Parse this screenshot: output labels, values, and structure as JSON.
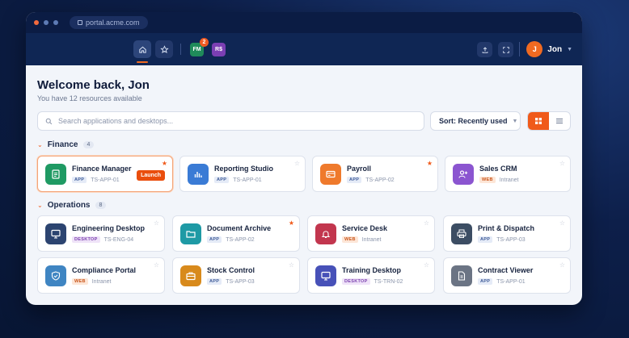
{
  "browser": {
    "url": "portal.acme.com"
  },
  "appbar": {
    "chips": [
      {
        "label": "FM",
        "color": "#1f8a5a",
        "badge": "2"
      },
      {
        "label": "R$",
        "color": "#7b3fb3"
      }
    ],
    "user": {
      "initial": "J",
      "name": "Jon"
    }
  },
  "header": {
    "title": "Welcome back, Jon",
    "subtitle": "You have 12 resources available"
  },
  "search": {
    "placeholder": "Search applications and desktops..."
  },
  "sort": {
    "label": "Sort: Recently used"
  },
  "colors": {
    "accent": "#f05a1a",
    "navy": "#0f2654"
  },
  "sections": [
    {
      "title": "Finance",
      "count": "4",
      "items": [
        {
          "name": "Finance Manager",
          "tag": "APP",
          "code": "TS-APP-01",
          "icon": "document-icon",
          "color": "#1f9a63",
          "fav": true,
          "launch": "Launch"
        },
        {
          "name": "Reporting Studio",
          "tag": "APP",
          "code": "TS-APP-01",
          "icon": "bar-chart-icon",
          "color": "#3a7bd5",
          "fav": false
        },
        {
          "name": "Payroll",
          "tag": "APP",
          "code": "TS-APP-02",
          "icon": "card-icon",
          "color": "#ef7a2c",
          "fav": true
        },
        {
          "name": "Sales CRM",
          "tag": "WEB",
          "code": "Intranet",
          "icon": "user-plus-icon",
          "color": "#8b55d0",
          "fav": false
        }
      ]
    },
    {
      "title": "Operations",
      "count": "8",
      "items": [
        {
          "name": "Engineering Desktop",
          "tag": "DESKTOP",
          "code": "TS-ENG-04",
          "icon": "monitor-icon",
          "color": "#2c4470",
          "fav": false
        },
        {
          "name": "Document Archive",
          "tag": "APP",
          "code": "TS-APP-02",
          "icon": "folder-icon",
          "color": "#1e9aa5",
          "fav": true
        },
        {
          "name": "Service Desk",
          "tag": "WEB",
          "code": "Intranet",
          "icon": "bell-icon",
          "color": "#c2364e",
          "fav": false
        },
        {
          "name": "Print & Dispatch",
          "tag": "APP",
          "code": "TS-APP-03",
          "icon": "printer-icon",
          "color": "#3c4d63",
          "fav": false
        },
        {
          "name": "Compliance Portal",
          "tag": "WEB",
          "code": "Intranet",
          "icon": "shield-icon",
          "color": "#3f85c2",
          "fav": false
        },
        {
          "name": "Stock Control",
          "tag": "APP",
          "code": "TS-APP-03",
          "icon": "briefcase-icon",
          "color": "#d88a1c",
          "fav": false
        },
        {
          "name": "Training Desktop",
          "tag": "DESKTOP",
          "code": "TS-TRN-02",
          "icon": "monitor-icon",
          "color": "#4751b8",
          "fav": false
        },
        {
          "name": "Contract Viewer",
          "tag": "APP",
          "code": "TS-APP-01",
          "icon": "file-icon",
          "color": "#6b7484",
          "fav": false
        }
      ]
    }
  ]
}
